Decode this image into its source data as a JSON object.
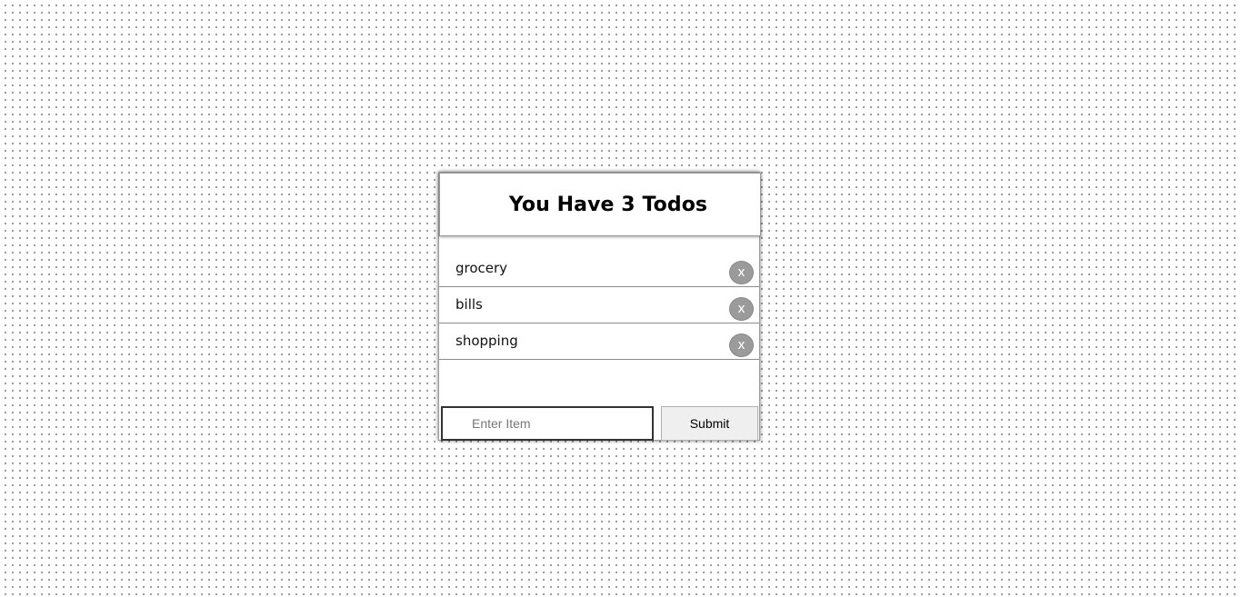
{
  "header": {
    "title": "You Have 3 Todos"
  },
  "todos": [
    {
      "text": "grocery",
      "delete_label": "x"
    },
    {
      "text": "bills",
      "delete_label": "x"
    },
    {
      "text": "shopping",
      "delete_label": "x"
    }
  ],
  "form": {
    "input_placeholder": "Enter Item",
    "input_value": "",
    "submit_label": "Submit"
  },
  "colors": {
    "background": "#ffffff",
    "delete_button": "#9b9b9b",
    "submit_button": "#efefef"
  }
}
